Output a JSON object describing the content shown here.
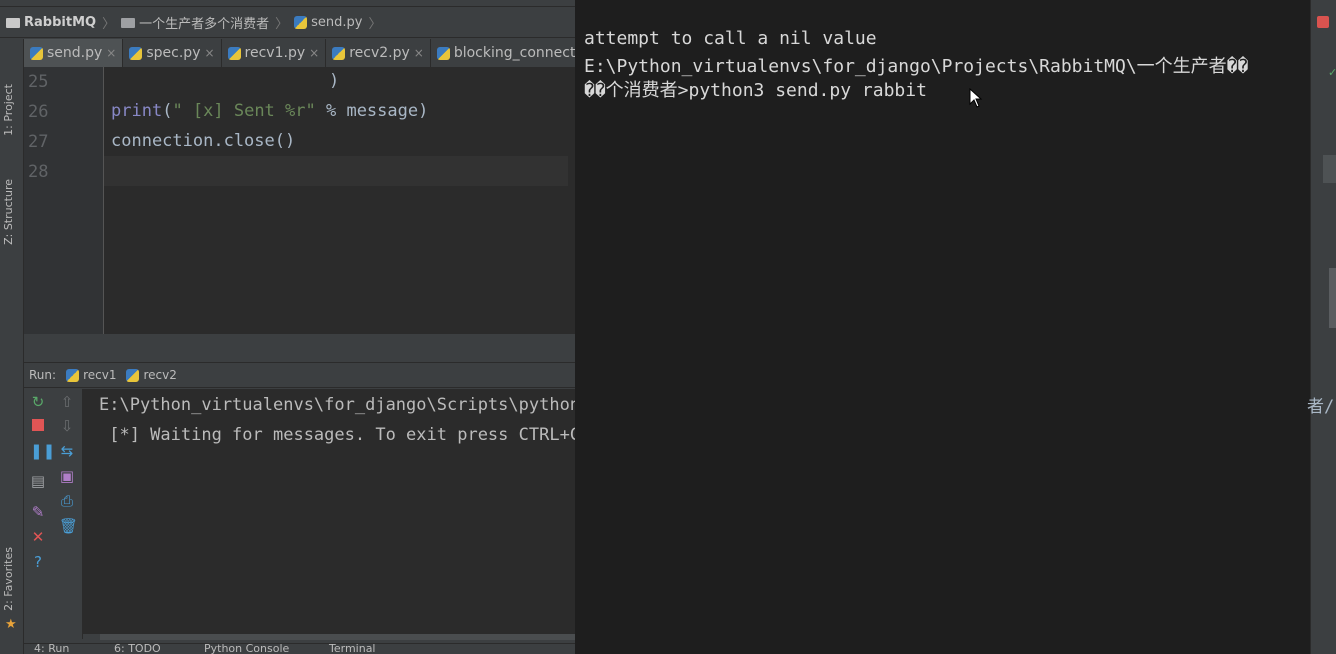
{
  "ide": {
    "breadcrumb": {
      "project": "RabbitMQ",
      "folder": "一个生产者多个消费者",
      "file": "send.py"
    },
    "tool_windows": {
      "project": "1: Project",
      "structure": "Z: Structure",
      "favorites": "2: Favorites"
    },
    "editor_tabs": [
      {
        "label": "send.py",
        "active": true
      },
      {
        "label": "spec.py",
        "active": false
      },
      {
        "label": "recv1.py",
        "active": false
      },
      {
        "label": "recv2.py",
        "active": false
      },
      {
        "label": "blocking_connecti",
        "active": false
      }
    ],
    "code": {
      "line_numbers": [
        "25",
        "26",
        "27",
        "28"
      ],
      "lines": [
        {
          "text": ")"
        },
        {
          "fn": "print",
          "paren_open": "(",
          "string": "\" [x] Sent %r\"",
          "op": " % ",
          "var": "message",
          "paren_close": ")"
        },
        {
          "text": "connection.close()"
        },
        {
          "text": ""
        }
      ]
    },
    "run": {
      "label": "Run:",
      "tabs": [
        "recv1",
        "recv2"
      ],
      "console": [
        "E:\\Python_virtualenvs\\for_django\\Scripts\\python.",
        " [*] Waiting for messages. To exit press CTRL+C"
      ]
    },
    "status_tabs": [
      "4: Run",
      "6: TODO",
      "Python Console",
      "Terminal"
    ]
  },
  "terminal": {
    "lines": [
      "attempt to call a nil value",
      "E:\\Python_virtualenvs\\for_django\\Projects\\RabbitMQ\\一个生产者��",
      "��个消费者>python3 send.py rabbit"
    ]
  },
  "right_strip": {
    "fragment": "者/"
  },
  "colors": {
    "ide_bg": "#3c3f41",
    "editor_bg": "#2b2b2b",
    "terminal_bg": "#1e1e1e",
    "keyword_print": "#8888c6",
    "string": "#6a8759",
    "line_number": "#606366"
  }
}
